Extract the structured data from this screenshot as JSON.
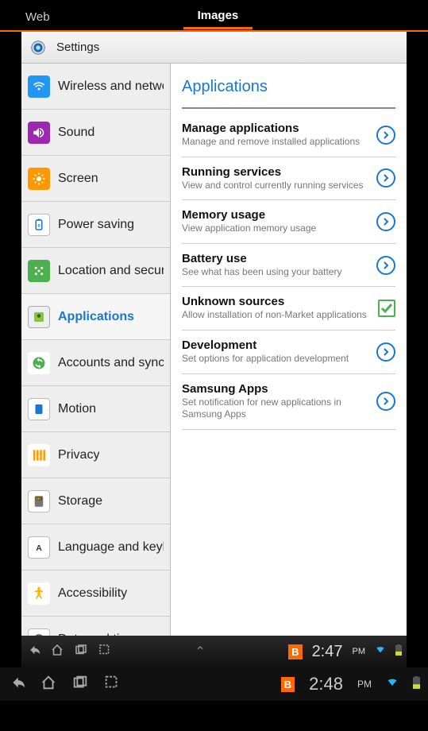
{
  "tabs": {
    "web": "Web",
    "images": "Images"
  },
  "header": {
    "title": "Settings"
  },
  "sidebar": {
    "items": [
      {
        "label": "Wireless and networks"
      },
      {
        "label": "Sound"
      },
      {
        "label": "Screen"
      },
      {
        "label": "Power saving"
      },
      {
        "label": "Location and security"
      },
      {
        "label": "Applications"
      },
      {
        "label": "Accounts and sync"
      },
      {
        "label": "Motion"
      },
      {
        "label": "Privacy"
      },
      {
        "label": "Storage"
      },
      {
        "label": "Language and keyboard"
      },
      {
        "label": "Accessibility"
      },
      {
        "label": "Date and time"
      }
    ]
  },
  "content": {
    "title": "Applications",
    "rows": [
      {
        "title": "Manage applications",
        "sub": "Manage and remove installed applications",
        "kind": "chev"
      },
      {
        "title": "Running services",
        "sub": "View and control currently running services",
        "kind": "chev"
      },
      {
        "title": "Memory usage",
        "sub": "View application memory usage",
        "kind": "chev"
      },
      {
        "title": "Battery use",
        "sub": "See what has been using your battery",
        "kind": "chev"
      },
      {
        "title": "Unknown sources",
        "sub": "Allow installation of non-Market applications",
        "kind": "check"
      },
      {
        "title": "Development",
        "sub": "Set options for application development",
        "kind": "chev"
      },
      {
        "title": "Samsung Apps",
        "sub": "Set notification for new applications in Samsung Apps",
        "kind": "chev"
      }
    ]
  },
  "statusbar_inner": {
    "badge": "B",
    "time": "2:47",
    "pm": "PM"
  },
  "statusbar_outer": {
    "badge": "B",
    "time": "2:48",
    "pm": "PM"
  }
}
